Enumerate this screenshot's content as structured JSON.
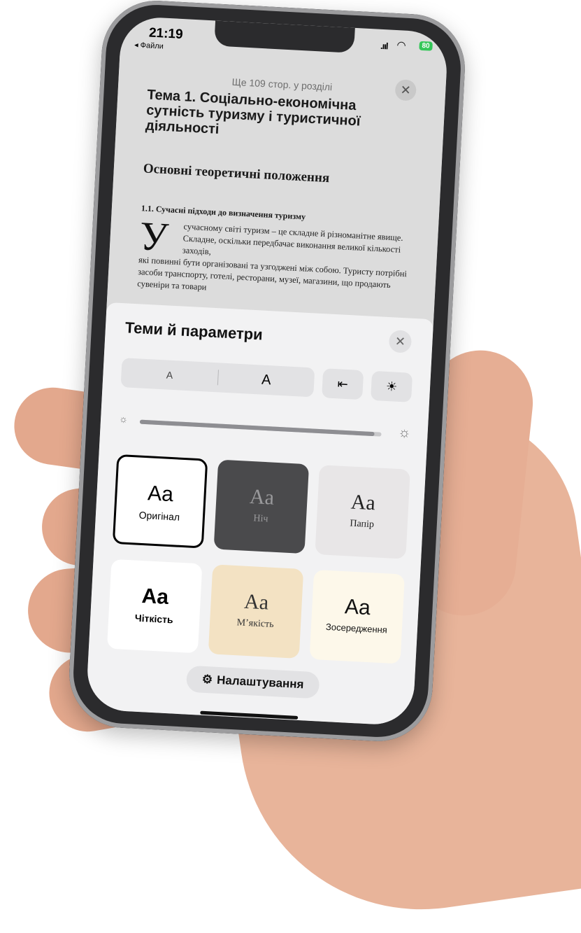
{
  "status": {
    "time": "21:19",
    "back_app": "◂ Файли",
    "battery": "80"
  },
  "reader": {
    "pages_left": "Ще 109 стор. у розділі",
    "chapter_title": "Тема 1. Соціально-економічна сутність туризму і туристичної діяльності",
    "section_heading": "Основні теоретичні положення",
    "subsection_heading": "1.1.  Сучасні підходи до визначення туризму",
    "drop_cap": "У",
    "paragraph_first_lines": "сучасному світі  туризм – це складне й різноманітне явище. Складне, оскільки передбачає виконання великої кількості заходів,",
    "paragraph_rest": "які повинні бути організовані та узгоджені між собою. Туристу потрібні засоби транспорту, готелі, ресторани, музеї, магазини, що продають сувеніри та товари"
  },
  "sheet": {
    "title": "Теми й параметри",
    "font_small": "A",
    "font_large": "A",
    "brightness_level": 0.97,
    "themes": [
      {
        "aa": "Aa",
        "name": "Оригінал",
        "selected": true
      },
      {
        "aa": "Aa",
        "name": "Ніч"
      },
      {
        "aa": "Aa",
        "name": "Папір"
      },
      {
        "aa": "Aa",
        "name": "Чіткість"
      },
      {
        "aa": "Aa",
        "name": "М’якість"
      },
      {
        "aa": "Aa",
        "name": "Зосередження"
      }
    ],
    "settings_label": "Налаштування"
  },
  "icons": {
    "close": "✕",
    "layout": "⇤",
    "brightness_mode": "☀",
    "sun_small": "☼",
    "sun_large": "☼",
    "gear": "⚙"
  },
  "colors": {
    "night_bg": "#4a4a4c",
    "paper_bg": "#e8e6e7",
    "calm_bg": "#f3e2c3",
    "focus_bg": "#fdf8ea",
    "battery": "#34c759"
  }
}
